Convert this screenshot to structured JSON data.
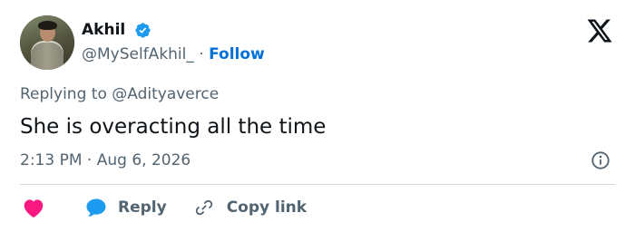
{
  "author": {
    "name": "Akhil",
    "handle": "@MySelfAkhil_",
    "separator": "·",
    "follow_label": "Follow",
    "verified_icon": "verified-badge-icon",
    "avatar": "profile-photo"
  },
  "platform_icon": "x-logo-icon",
  "reply_context": {
    "prefix": "Replying to",
    "mention": "@Adityaverce"
  },
  "tweet": {
    "text": "She is overacting all the time",
    "time": "2:13 PM",
    "separator": "·",
    "date": "Aug 6, 2026"
  },
  "actions": {
    "like_icon": "heart-icon",
    "reply_label": "Reply",
    "reply_icon": "speech-bubble-icon",
    "copy_link_label": "Copy link",
    "copy_link_icon": "link-icon"
  },
  "colors": {
    "accent_blue": "#1d9bf0",
    "follow_blue": "#006fd6",
    "heart_red": "#f91880",
    "muted_text": "#536471",
    "primary_text": "#0f1419",
    "divider": "#cfd9de"
  }
}
